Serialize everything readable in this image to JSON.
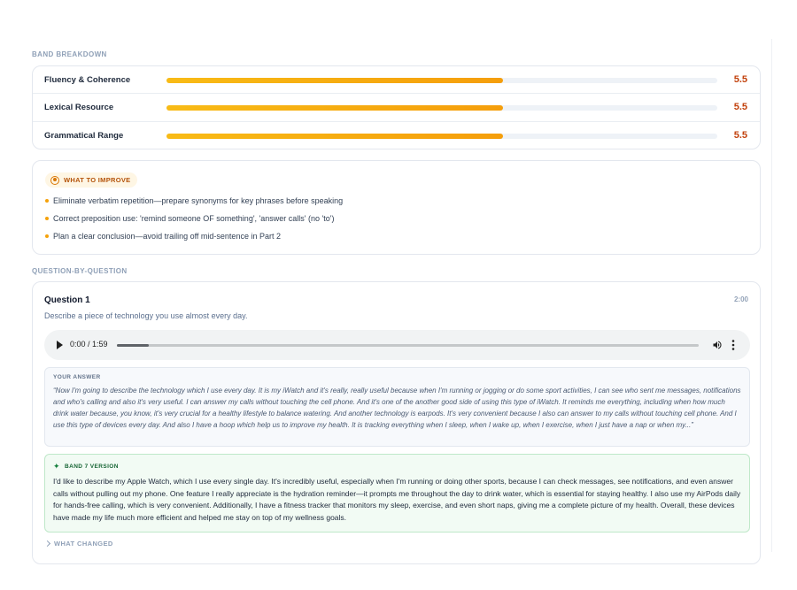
{
  "band_breakdown": {
    "label": "BAND BREAKDOWN",
    "max_score": 9,
    "rows": [
      {
        "name": "Fluency & Coherence",
        "score": "5.5",
        "fill_fraction": 0.611
      },
      {
        "name": "Lexical Resource",
        "score": "5.5",
        "fill_fraction": 0.611
      },
      {
        "name": "Grammatical Range",
        "score": "5.5",
        "fill_fraction": 0.611
      }
    ]
  },
  "improve": {
    "title": "WHAT TO IMPROVE",
    "icon": "target-icon",
    "items": [
      "Eliminate verbatim repetition—prepare synonyms for key phrases before speaking",
      "Correct preposition use: 'remind someone OF something', 'answer calls' (no 'to')",
      "Plan a clear conclusion—avoid trailing off mid-sentence in Part 2"
    ]
  },
  "questions_section": {
    "label": "QUESTION-BY-QUESTION"
  },
  "question": {
    "title": "Question 1",
    "time": "2:00",
    "prompt": "Describe a piece of technology you use almost every day.",
    "audio": {
      "time_display": "0:00 / 1:59",
      "progress_fraction": 0.055
    },
    "answer_label": "YOUR ANSWER",
    "answer_text": "“Now I'm going to describe the technology which I use every day. It is my iWatch and it's really, really useful because when I'm running or jogging or do some sport activities, I can see who sent me messages, notifications and who's calling and also it's very useful. I can answer my calls without touching the cell phone. And it's one of the another good side of using this type of iWatch. It reminds me everything, including when how much drink water because, you know, it's very crucial for a healthy lifestyle to balance watering. And another technology is earpods. It's very convenient because I also can answer to my calls without touching cell phone. And I use this type of devices every day. And also I have a hoop which help us to improve my health. It is tracking everything when I sleep, when I wake up, when I exercise, when I just have a nap or when my...”",
    "band7_label": "BAND 7 VERSION",
    "band7_text": "I'd like to describe my Apple Watch, which I use every single day. It's incredibly useful, especially when I'm running or doing other sports, because I can check messages, see notifications, and even answer calls without pulling out my phone. One feature I really appreciate is the hydration reminder—it prompts me throughout the day to drink water, which is essential for staying healthy. I also use my AirPods daily for hands-free calling, which is very convenient. Additionally, I have a fitness tracker that monitors my sleep, exercise, and even short naps, giving me a complete picture of my health. Overall, these devices have made my life much more efficient and helped me stay on top of my wellness goals.",
    "changed_label": "WHAT CHANGED"
  },
  "colors": {
    "accent_orange": "#f59e0b",
    "score_color": "#c2410c",
    "band7_bg": "#f2fbf4"
  }
}
